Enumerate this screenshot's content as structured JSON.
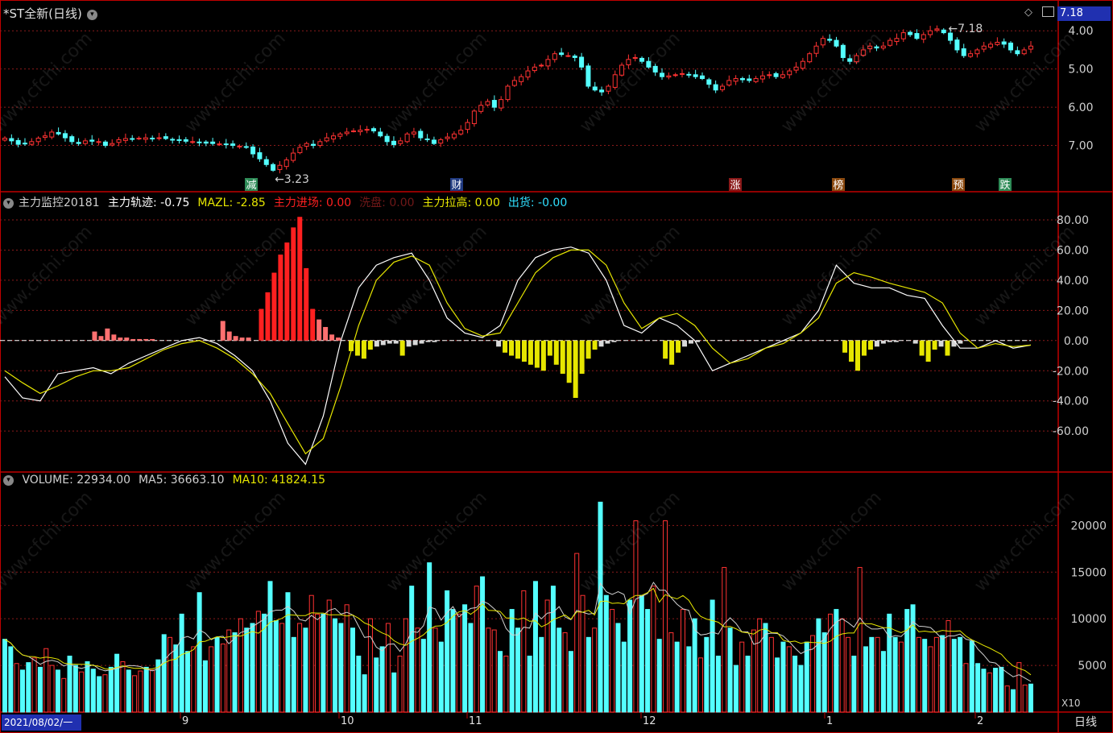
{
  "title": "*ST全新(日线)",
  "price_box": "7.18",
  "watermark": "www.cfchi.com",
  "panel1": {
    "yticks": [
      "7.00",
      "6.00",
      "5.00",
      "4.00"
    ],
    "high_label": "7.18",
    "low_label": "3.23",
    "markers": [
      "减",
      "财",
      "涨",
      "榜",
      "预",
      "跌"
    ]
  },
  "panel2": {
    "name": "主力监控20181",
    "items": [
      {
        "label": "主力轨迹: -0.75",
        "color": "#ffffff"
      },
      {
        "label": "MAZL: -2.85",
        "color": "#e6e600"
      },
      {
        "label": "主力进场: 0.00",
        "color": "#ff2020"
      },
      {
        "label": "洗盘: 0.00",
        "color": "#701818"
      },
      {
        "label": "主力拉高: 0.00",
        "color": "#e6e600"
      },
      {
        "label": "出货: -0.00",
        "color": "#30e0ff"
      }
    ],
    "yticks": [
      "80.00",
      "60.00",
      "40.00",
      "20.00",
      "0.00",
      "-20.00",
      "-40.00",
      "-60.00"
    ]
  },
  "panel3": {
    "items": [
      {
        "label": "VOLUME: 22934.00",
        "color": "#d0d0d0"
      },
      {
        "label": "MA5: 36663.10",
        "color": "#d0d0d0"
      },
      {
        "label": "MA10: 41824.15",
        "color": "#e6e600"
      }
    ],
    "yticks": [
      "20000",
      "15000",
      "10000",
      "5000"
    ],
    "multiplier": "X10"
  },
  "xaxis": {
    "start": "2021/08/02/一",
    "months": [
      "9",
      "10",
      "11",
      "12",
      "1",
      "2"
    ],
    "period": "日线"
  },
  "colors": {
    "up": "#ff3232",
    "down": "#54ffff",
    "grid": "#8b1a1a",
    "axis": "#c00000"
  },
  "chart_data": [
    {
      "type": "candlestick",
      "panel": "price",
      "ylim": [
        3.0,
        7.3
      ],
      "yticks": [
        4,
        5,
        6,
        7
      ],
      "close": [
        4.19,
        4.12,
        4.03,
        4.05,
        4.1,
        4.19,
        4.25,
        4.35,
        4.3,
        4.2,
        4.1,
        4.05,
        4.12,
        4.11,
        4.1,
        4.0,
        4.05,
        4.15,
        4.18,
        4.16,
        4.19,
        4.2,
        4.18,
        4.2,
        4.18,
        4.15,
        4.13,
        4.11,
        4.1,
        4.08,
        4.06,
        4.05,
        4.04,
        4.02,
        4.0,
        3.98,
        3.95,
        3.78,
        3.65,
        3.5,
        3.35,
        3.48,
        3.62,
        3.8,
        3.95,
        4.05,
        4.0,
        4.1,
        4.2,
        4.25,
        4.3,
        4.35,
        4.38,
        4.4,
        4.42,
        4.38,
        4.25,
        4.1,
        4.02,
        4.12,
        4.3,
        4.35,
        4.2,
        4.15,
        4.05,
        4.15,
        4.22,
        4.3,
        4.4,
        4.6,
        4.9,
        5.05,
        5.15,
        5.0,
        5.2,
        5.55,
        5.7,
        5.8,
        5.95,
        6.05,
        6.1,
        6.25,
        6.4,
        6.38,
        6.35,
        6.3,
        6.05,
        5.55,
        5.45,
        5.4,
        5.55,
        5.85,
        6.1,
        6.25,
        6.3,
        6.2,
        6.05,
        5.92,
        5.8,
        5.82,
        5.85,
        5.88,
        5.85,
        5.8,
        5.75,
        5.6,
        5.45,
        5.55,
        5.7,
        5.75,
        5.72,
        5.7,
        5.75,
        5.82,
        5.85,
        5.8,
        5.85,
        5.95,
        6.05,
        6.2,
        6.4,
        6.6,
        6.8,
        6.75,
        6.6,
        6.3,
        6.2,
        6.35,
        6.5,
        6.6,
        6.55,
        6.6,
        6.75,
        6.8,
        6.95,
        6.9,
        6.8,
        6.9,
        7.0,
        7.05,
        6.95,
        6.75,
        6.5,
        6.35,
        6.4,
        6.5,
        6.6,
        6.65,
        6.7,
        6.65,
        6.5,
        6.4,
        6.5,
        6.6
      ],
      "high_marker": 7.18,
      "low_marker": 3.23
    },
    {
      "type": "line",
      "panel": "indicator",
      "ylim": [
        -85,
        88
      ],
      "yticks": [
        80,
        60,
        40,
        20,
        0,
        -20,
        -40,
        -60
      ],
      "series": [
        {
          "name": "主力轨迹",
          "color": "#ffffff",
          "values": [
            -24,
            -38,
            -40,
            -22,
            -20,
            -18,
            -22,
            -15,
            -10,
            -5,
            0,
            2,
            -2,
            -10,
            -20,
            -40,
            -68,
            -82,
            -50,
            0,
            35,
            50,
            55,
            58,
            40,
            15,
            5,
            2,
            10,
            40,
            55,
            60,
            62,
            58,
            40,
            10,
            5,
            15,
            10,
            0,
            -20,
            -15,
            -10,
            -5,
            0,
            5,
            20,
            50,
            38,
            35,
            35,
            30,
            28,
            10,
            -5,
            -5,
            0,
            -5,
            -3
          ]
        },
        {
          "name": "MAZL",
          "color": "#e6e600",
          "values": [
            -20,
            -28,
            -35,
            -30,
            -24,
            -20,
            -20,
            -18,
            -12,
            -6,
            -2,
            0,
            -5,
            -12,
            -22,
            -35,
            -55,
            -75,
            -65,
            -30,
            10,
            40,
            52,
            56,
            50,
            25,
            8,
            3,
            5,
            25,
            45,
            55,
            60,
            60,
            50,
            25,
            8,
            15,
            18,
            10,
            -5,
            -15,
            -12,
            -5,
            -2,
            5,
            15,
            38,
            45,
            42,
            38,
            35,
            32,
            25,
            5,
            -5,
            -2,
            -4,
            -3
          ]
        }
      ],
      "histogram": [
        0,
        0,
        0,
        0,
        0,
        0,
        0,
        0,
        0,
        0,
        0,
        0,
        0,
        0,
        6,
        3,
        8,
        4,
        2,
        2,
        1,
        1,
        1,
        1,
        0,
        0,
        0,
        0,
        0,
        0,
        0,
        0,
        0,
        0,
        13,
        6,
        3,
        2,
        2,
        0,
        21,
        32,
        45,
        57,
        65,
        75,
        82,
        48,
        21,
        14,
        9,
        4,
        2,
        0,
        -7,
        -10,
        -12,
        -6,
        -4,
        -3,
        -2,
        -2,
        -10,
        -4,
        -3,
        -2,
        -1,
        -1,
        0,
        0,
        0,
        0,
        0,
        0,
        0,
        0,
        0,
        -4,
        -8,
        -10,
        -12,
        -14,
        -16,
        -18,
        -20,
        -10,
        -16,
        -22,
        -28,
        -38,
        -22,
        -12,
        -6,
        -4,
        -2,
        -1,
        0,
        0,
        0,
        0,
        0,
        0,
        0,
        -12,
        -16,
        -8,
        -4,
        -2,
        -1,
        0,
        0,
        0,
        0,
        0,
        0,
        0,
        0,
        0,
        0,
        0,
        0,
        0,
        0,
        0,
        0,
        0,
        0,
        0,
        0,
        0,
        0,
        -8,
        -14,
        -20,
        -10,
        -6,
        -4,
        -2,
        -1,
        -1,
        0,
        0,
        -2,
        -10,
        -14,
        -6,
        -4,
        -10,
        -4,
        -2,
        0,
        0,
        0,
        0,
        0,
        0,
        0,
        0,
        0,
        0,
        0
      ]
    },
    {
      "type": "bar",
      "panel": "volume",
      "ylim": [
        0,
        24000
      ],
      "yticks": [
        5000,
        10000,
        15000,
        20000
      ],
      "values": [
        7800,
        7000,
        5200,
        4500,
        5300,
        5800,
        4800,
        6800,
        5000,
        4500,
        3600,
        6000,
        5000,
        4300,
        5400,
        4600,
        3800,
        4000,
        4800,
        6200,
        5400,
        4500,
        3900,
        4400,
        4800,
        4500,
        5600,
        8300,
        8000,
        7200,
        10500,
        6500,
        7000,
        12800,
        5500,
        7000,
        8000,
        7300,
        8800,
        8500,
        10000,
        9000,
        9500,
        10800,
        10500,
        14000,
        9800,
        9500,
        12800,
        8000,
        9500,
        9000,
        12500,
        10500,
        10500,
        12000,
        10000,
        9500,
        11500,
        9000,
        6000,
        4000,
        10000,
        5800,
        7000,
        9500,
        4200,
        6000,
        10000,
        13500,
        9000,
        7800,
        16000,
        9000,
        7500,
        13000,
        11000,
        10500,
        11500,
        9500,
        13500,
        14500,
        9000,
        8800,
        6500,
        6000,
        11000,
        9000,
        13000,
        6000,
        14000,
        8000,
        12000,
        13500,
        9000,
        8500,
        6500,
        17000,
        12500,
        8000,
        9000,
        22500,
        12500,
        11000,
        9500,
        7500,
        12000,
        20500,
        12500,
        11000,
        13500,
        7800,
        20500,
        8500,
        7500,
        11000,
        7000,
        10000,
        5800,
        8000,
        12000,
        6000,
        15500,
        9000,
        5000,
        7500,
        6000,
        8800,
        10000,
        9500,
        8000,
        5800,
        7500,
        7000,
        6000,
        5000,
        7500,
        8200,
        10000,
        8500,
        10500,
        11000,
        10000,
        8000,
        6000,
        15500,
        7000,
        8000,
        8000,
        6500,
        10500,
        8000,
        7500,
        11000,
        11500,
        8000,
        7800,
        7000,
        8000,
        8200,
        9800,
        7800,
        8000,
        5200,
        7600,
        5200,
        4600,
        4200,
        4700,
        4800,
        2800,
        2400,
        5300,
        2900,
        3000
      ],
      "series": [
        {
          "name": "MA5",
          "color": "#d0d0d0"
        },
        {
          "name": "MA10",
          "color": "#e6e600"
        }
      ]
    }
  ]
}
